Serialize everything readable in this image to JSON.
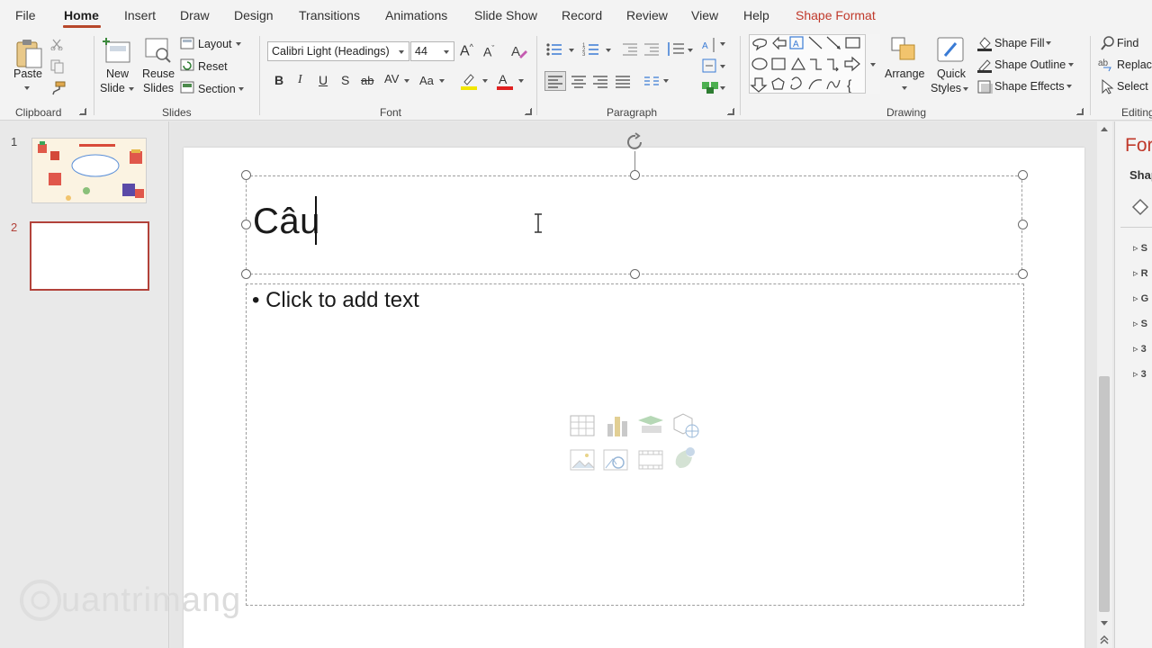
{
  "menu": {
    "tabs": [
      "File",
      "Home",
      "Insert",
      "Draw",
      "Design",
      "Transitions",
      "Animations",
      "Slide Show",
      "Record",
      "Review",
      "View",
      "Help",
      "Shape Format"
    ]
  },
  "ribbon": {
    "clipboard": {
      "paste": "Paste",
      "label": "Clipboard"
    },
    "slides": {
      "new_slide_1": "New",
      "new_slide_2": "Slide",
      "reuse_1": "Reuse",
      "reuse_2": "Slides",
      "layout": "Layout",
      "reset": "Reset",
      "section": "Section",
      "label": "Slides"
    },
    "font": {
      "font_name": "Calibri Light (Headings)",
      "font_size": "44",
      "label": "Font"
    },
    "paragraph": {
      "label": "Paragraph"
    },
    "drawing": {
      "arrange": "Arrange",
      "quick_styles_1": "Quick",
      "quick_styles_2": "Styles",
      "shape_fill": "Shape Fill",
      "shape_outline": "Shape Outline",
      "shape_effects": "Shape Effects",
      "label": "Drawing"
    },
    "editing": {
      "find": "Find",
      "replace": "Replac",
      "select": "Select",
      "label": "Editing"
    }
  },
  "slides_panel": {
    "items": [
      {
        "number": "1"
      },
      {
        "number": "2"
      }
    ]
  },
  "slide": {
    "title_text": "Câu",
    "content_placeholder": "• Click to add text"
  },
  "format_pane": {
    "title": "For",
    "subtitle": "Shap",
    "items": [
      "S",
      "R",
      "G",
      "S",
      "3",
      "3"
    ]
  },
  "watermark": "uantrimang",
  "colors": {
    "accent": "#b7472a",
    "shape_format": "#c0392b",
    "selected_thumb": "#b2423a"
  }
}
